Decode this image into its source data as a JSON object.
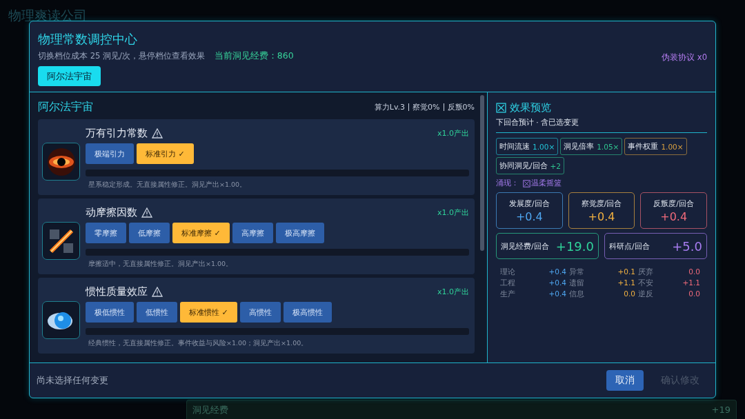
{
  "background": {
    "title": "物理爽读公司",
    "footer_label": "洞见经费",
    "footer_value": "+19"
  },
  "dialog": {
    "title": "物理常数调控中心",
    "subtitle": "切换档位成本 25 洞见/次，悬停档位查看效果",
    "funds": "当前洞见经费：860",
    "disguise": "伪装协议 x0",
    "universes": [
      {
        "label": "阿尔法宇宙",
        "selected": true
      }
    ]
  },
  "panel": {
    "title": "阿尔法宇宙",
    "stats": [
      "算力Lv.3",
      "察觉0%",
      "反叛0%"
    ]
  },
  "constants": [
    {
      "name": "万有引力常数",
      "warning": true,
      "output": "x1.0产出",
      "options": [
        {
          "label": "极端引力",
          "selected": false
        },
        {
          "label": "标准引力 ✓",
          "selected": true
        }
      ],
      "description": "星系稳定形成。无直接属性修正。洞见产出×1.00。"
    },
    {
      "name": "动摩擦因数",
      "warning": true,
      "output": "x1.0产出",
      "options": [
        {
          "label": "零摩擦",
          "selected": false
        },
        {
          "label": "低摩擦",
          "selected": false
        },
        {
          "label": "标准摩擦 ✓",
          "selected": true
        },
        {
          "label": "高摩擦",
          "selected": false
        },
        {
          "label": "极高摩擦",
          "selected": false
        }
      ],
      "description": "摩擦适中，无直接属性修正。洞见产出×1.00。"
    },
    {
      "name": "惯性质量效应",
      "warning": true,
      "output": "x1.0产出",
      "options": [
        {
          "label": "极低惯性",
          "selected": false
        },
        {
          "label": "低惯性",
          "selected": false
        },
        {
          "label": "标准惯性 ✓",
          "selected": true
        },
        {
          "label": "高惯性",
          "selected": false
        },
        {
          "label": "极高惯性",
          "selected": false
        }
      ],
      "description": "经典惯性，无直接属性修正。事件收益与风险×1.00；洞见产出×1.00。"
    }
  ],
  "preview": {
    "title": "效果预览",
    "subtitle": "下回合预计 · 含已选变更",
    "chips": [
      {
        "label": "时间流速",
        "value": "1.00×",
        "color": "#22c5d8"
      },
      {
        "label": "洞见倍率",
        "value": "1.05×",
        "color": "#2fc48f"
      },
      {
        "label": "事件权重",
        "value": "1.00×",
        "color": "#d9a040"
      },
      {
        "label": "协同洞见/回合",
        "value": "+2",
        "color": "#2fc48f"
      }
    ],
    "emergence_label": "涌现：",
    "emergence_value": "温柔摇篮",
    "stats": [
      {
        "kind": "tall",
        "label": "发展度/回合",
        "value": "+0.4",
        "color": "#4ea6f0"
      },
      {
        "kind": "tall",
        "label": "察觉度/回合",
        "value": "+0.4",
        "color": "#f0b040"
      },
      {
        "kind": "tall",
        "label": "反叛度/回合",
        "value": "+0.4",
        "color": "#f06a7a"
      },
      {
        "kind": "wide",
        "label": "洞见经费/回合",
        "value": "+19.0",
        "color": "#2fd39a"
      },
      {
        "kind": "wide",
        "label": "科研点/回合",
        "value": "+5.0",
        "color": "#a77cf0"
      }
    ],
    "breakdown": [
      {
        "label": "理论",
        "value": "+0.4",
        "color": "#4ea6f0"
      },
      {
        "label": "异常",
        "value": "+0.1",
        "color": "#f0b040"
      },
      {
        "label": "厌弃",
        "value": "0.0",
        "color": "#f06a7a"
      },
      {
        "label": "工程",
        "value": "+0.4",
        "color": "#4ea6f0"
      },
      {
        "label": "遗留",
        "value": "+1.1",
        "color": "#f0b040"
      },
      {
        "label": "不安",
        "value": "+1.1",
        "color": "#f06a7a"
      },
      {
        "label": "生产",
        "value": "+0.4",
        "color": "#4ea6f0"
      },
      {
        "label": "信息",
        "value": "0.0",
        "color": "#f0b040"
      },
      {
        "label": "逆反",
        "value": "0.0",
        "color": "#f06a7a"
      }
    ]
  },
  "footer": {
    "status": "尚未选择任何变更",
    "buttons": [
      {
        "label": "取消",
        "disabled": false
      },
      {
        "label": "确认修改",
        "disabled": true
      }
    ]
  }
}
